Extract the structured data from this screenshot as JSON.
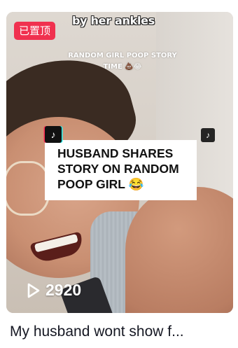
{
  "video_card": {
    "pinned_badge": "已置顶",
    "overlay_top_caption": "by her ankles",
    "overlay_sub_caption": "RANDOM GIRL POOP STORY TIME 💩😂",
    "headline_lines": [
      "HUSBAND SHARES",
      "STORY ON RANDOM",
      "POOP GIRL 😂"
    ],
    "tiktok_logo_glyph": "♪",
    "views_icon": "play-icon",
    "views_count": "2920",
    "title": "My husband wont show f..."
  },
  "colors": {
    "pinned_badge_bg": "#f0314f",
    "title_text": "#161823"
  }
}
